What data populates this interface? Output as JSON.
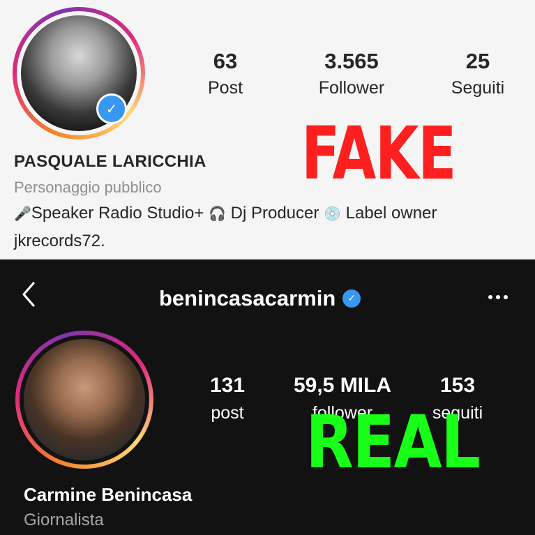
{
  "fake_profile": {
    "stats": [
      {
        "value": "63",
        "label": "Post"
      },
      {
        "value": "3.565",
        "label": "Follower"
      },
      {
        "value": "25",
        "label": "Seguiti"
      }
    ],
    "name": "PASQUALE LARICCHIA",
    "category": "Personaggio pubblico",
    "bio_line1": {
      "icon1": "🎤",
      "text1": "Speaker Radio Studio+ ",
      "icon2": "🎧",
      "text2": " Dj Producer ",
      "icon3": "💿",
      "text3": " Label owner"
    },
    "bio_line2": "jkrecords72.",
    "verified": true,
    "stamp": "FAKE",
    "stamp_color": "#ff1f1f"
  },
  "real_profile": {
    "username": "benincasacarmin",
    "stats": [
      {
        "value": "131",
        "label": "post"
      },
      {
        "value": "59,5 MILA",
        "label": "follower"
      },
      {
        "value": "153",
        "label": "seguiti"
      }
    ],
    "name": "Carmine Benincasa",
    "category": "Giornalista",
    "verified": true,
    "stamp": "REAL",
    "stamp_color": "#18ff18"
  },
  "icons": {
    "back": "chevron-left-icon",
    "more": "more-horizontal-icon",
    "verified": "verified-badge-icon"
  }
}
